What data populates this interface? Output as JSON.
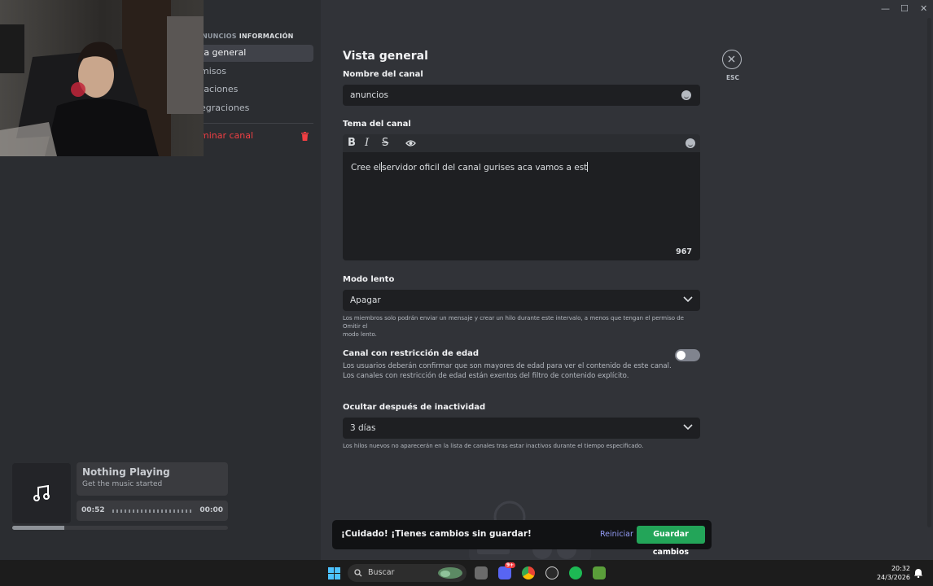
{
  "window": {
    "minimize": "—",
    "maximize": "☐",
    "close": "✕"
  },
  "sidebar": {
    "header_prefix": "NUNCIOS",
    "header_strong": "INFORMACIÓN",
    "items": [
      {
        "label": "ta general"
      },
      {
        "label": "misos"
      },
      {
        "label": "taciones"
      },
      {
        "label": "egraciones"
      }
    ],
    "delete_label": "minar canal"
  },
  "music": {
    "title": "Nothing Playing",
    "subtitle": "Get the music started",
    "elapsed": "00:52",
    "remaining": "00:00",
    "progress": 0.24
  },
  "main": {
    "title": "Vista general",
    "channel_name_label": "Nombre del canal",
    "channel_name_value": "anuncios",
    "topic_label": "Tema del canal",
    "topic_text_before": "Cree el",
    "topic_text_after": "servidor oficil del canal gurises aca vamos a est",
    "char_count": "967",
    "toolbar": {
      "bold": "B",
      "italic": "I",
      "strike": "S"
    },
    "slowmode_label": "Modo lento",
    "slowmode_value": "Apagar",
    "slowmode_hint_1": "Los miembros solo podrán enviar un mensaje y crear un hilo durante este intervalo, a menos que tengan el permiso de Omitir el",
    "slowmode_hint_2": "modo lento.",
    "age_label": "Canal con restricción de edad",
    "age_desc_1": "Los usuarios deberán confirmar que son mayores de edad para ver el contenido de este canal.",
    "age_desc_2": "Los canales con restricción de edad están exentos del filtro de contenido explícito.",
    "age_enabled": false,
    "inactivity_label": "Ocultar después de inactividad",
    "inactivity_value": "3 días",
    "inactivity_hint": "Los hilos nuevos no aparecerán en la lista de canales tras estar inactivos durante el tiempo especificado.",
    "esc_label": "ESC"
  },
  "unsaved": {
    "message": "¡Cuidado! ¡Tienes cambios sin guardar!",
    "reset_label": "Reiniciar",
    "save_label": "Guardar cambios"
  },
  "taskbar": {
    "search_placeholder": "Buscar",
    "discord_badge": "9+",
    "time": "20:32",
    "date": "24/3/2026"
  },
  "colors": {
    "accent_green": "#23a559",
    "danger": "#f23f43",
    "link": "#949cf7",
    "background": "#313338",
    "sidebar": "#2b2d31"
  }
}
